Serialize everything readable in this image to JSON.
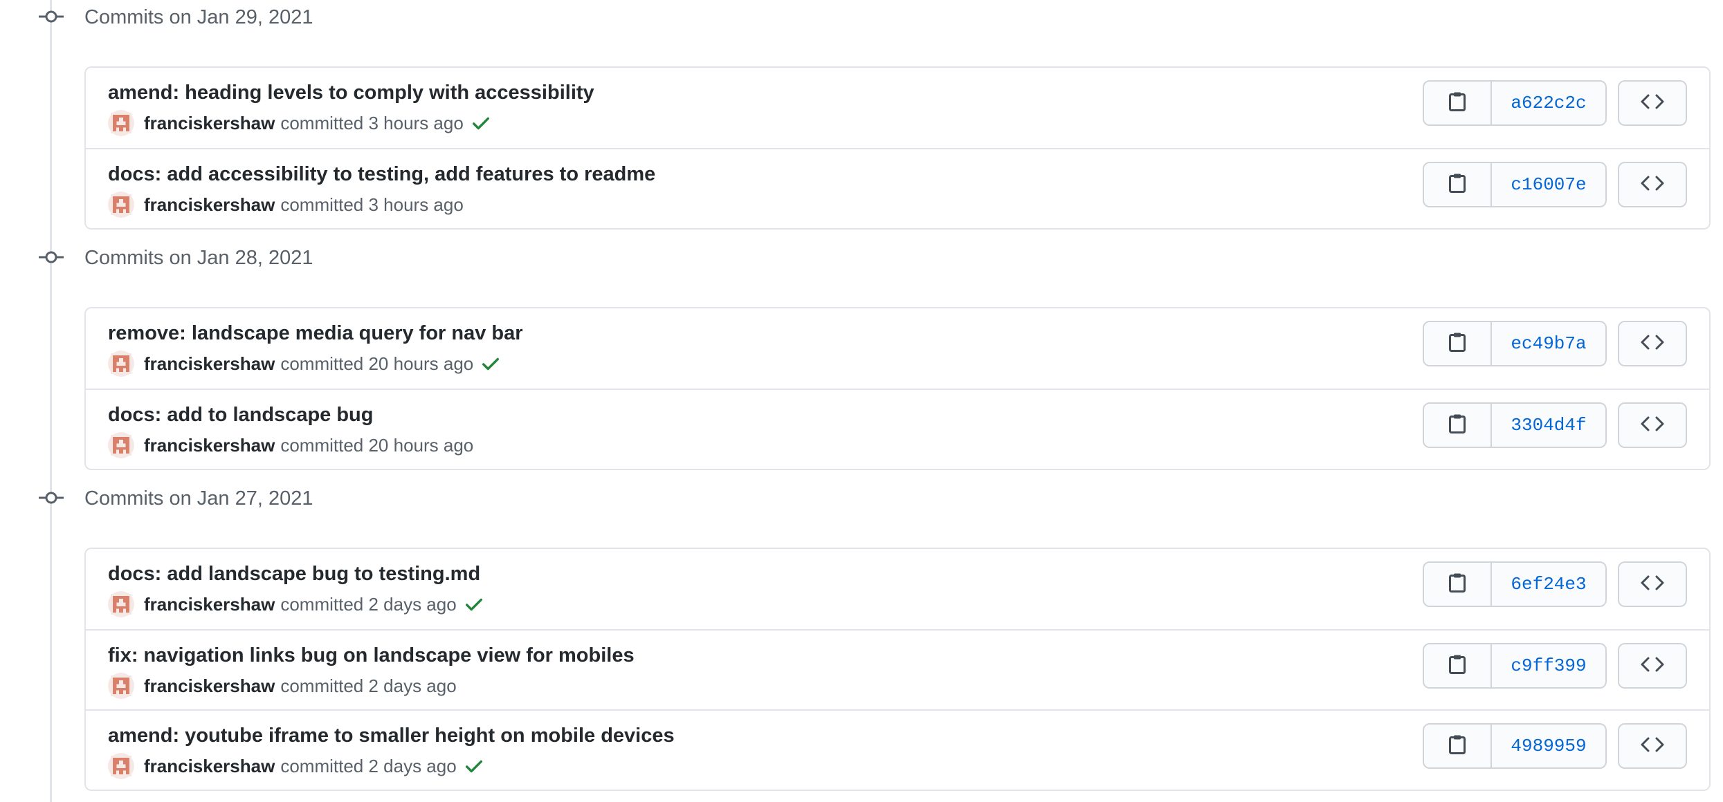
{
  "groups": [
    {
      "title": "Commits on Jan 29, 2021",
      "commits": [
        {
          "message": "amend: heading levels to comply with accessibility",
          "author": "franciskershaw",
          "time": "committed 3 hours ago",
          "verified": true,
          "sha": "a622c2c"
        },
        {
          "message": "docs: add accessibility to testing, add features to readme",
          "author": "franciskershaw",
          "time": "committed 3 hours ago",
          "verified": false,
          "sha": "c16007e"
        }
      ]
    },
    {
      "title": "Commits on Jan 28, 2021",
      "commits": [
        {
          "message": "remove: landscape media query for nav bar",
          "author": "franciskershaw",
          "time": "committed 20 hours ago",
          "verified": true,
          "sha": "ec49b7a"
        },
        {
          "message": "docs: add to landscape bug",
          "author": "franciskershaw",
          "time": "committed 20 hours ago",
          "verified": false,
          "sha": "3304d4f"
        }
      ]
    },
    {
      "title": "Commits on Jan 27, 2021",
      "commits": [
        {
          "message": "docs: add landscape bug to testing.md",
          "author": "franciskershaw",
          "time": "committed 2 days ago",
          "verified": true,
          "sha": "6ef24e3"
        },
        {
          "message": "fix: navigation links bug on landscape view for mobiles",
          "author": "franciskershaw",
          "time": "committed 2 days ago",
          "verified": false,
          "sha": "c9ff399"
        },
        {
          "message": "amend: youtube iframe to smaller height on mobile devices",
          "author": "franciskershaw",
          "time": "committed 2 days ago",
          "verified": true,
          "sha": "4989959"
        }
      ]
    }
  ],
  "icons": {
    "commit_node": "git-commit-icon",
    "avatar": "identicon-avatar",
    "verified": "check-icon",
    "copy": "clipboard-icon",
    "browse": "code-icon"
  },
  "colors": {
    "sha_link": "#0366d6",
    "check": "#22863a",
    "avatar": "#d9806a"
  }
}
